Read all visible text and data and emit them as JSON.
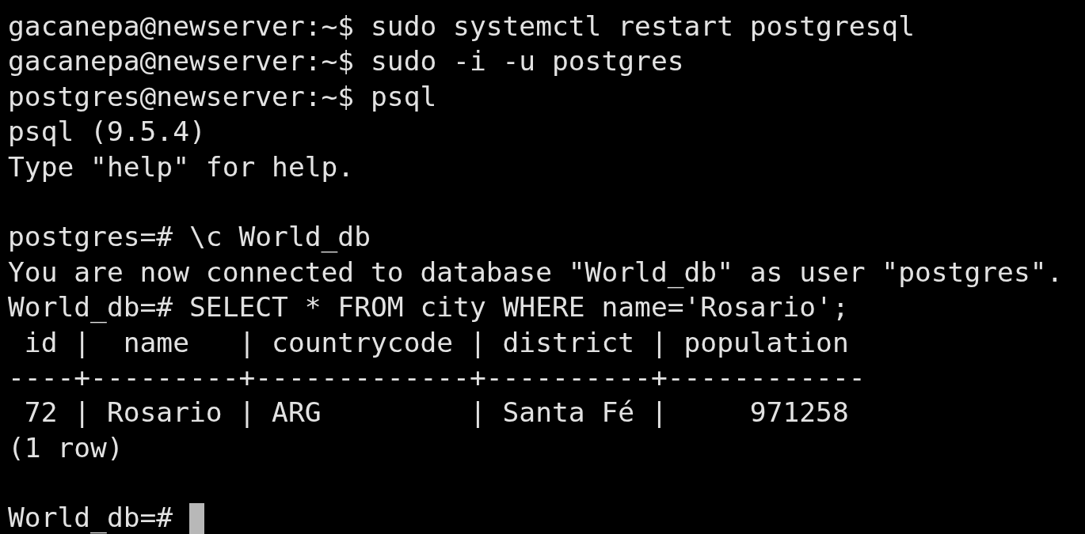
{
  "terminal": {
    "lines": [
      {
        "kind": "output",
        "text": "gacanepa@newserver:~$ sudo systemctl restart postgresql"
      },
      {
        "kind": "output",
        "text": "gacanepa@newserver:~$ sudo -i -u postgres"
      },
      {
        "kind": "output",
        "text": "postgres@newserver:~$ psql"
      },
      {
        "kind": "output",
        "text": "psql (9.5.4)"
      },
      {
        "kind": "output",
        "text": "Type \"help\" for help."
      },
      {
        "kind": "blank"
      },
      {
        "kind": "output",
        "text": "postgres=# \\c World_db"
      },
      {
        "kind": "output",
        "text": "You are now connected to database \"World_db\" as user \"postgres\"."
      },
      {
        "kind": "output",
        "text": "World_db=# SELECT * FROM city WHERE name='Rosario';"
      },
      {
        "kind": "output",
        "text": " id |  name   | countrycode | district | population"
      },
      {
        "kind": "output",
        "text": "----+---------+-------------+----------+------------"
      },
      {
        "kind": "output",
        "text": " 72 | Rosario | ARG         | Santa Fé |     971258"
      },
      {
        "kind": "output",
        "text": "(1 row)"
      },
      {
        "kind": "blank"
      }
    ],
    "input_line": {
      "prompt": "World_db=#"
    }
  }
}
